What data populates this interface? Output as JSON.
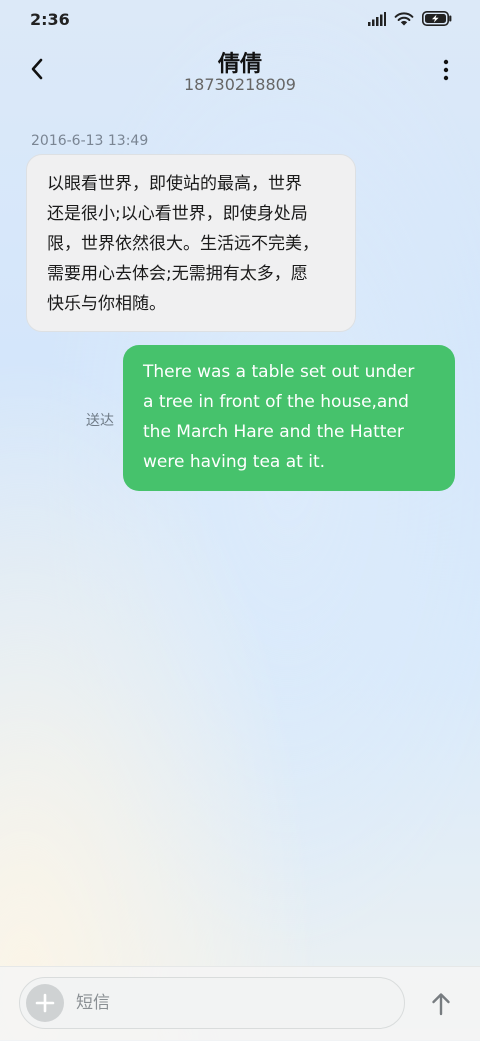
{
  "status_bar": {
    "time": "2:36",
    "icons": [
      "signal-icon",
      "wifi-icon",
      "battery-charging-icon"
    ]
  },
  "header": {
    "contact_name": "倩倩",
    "contact_number": "18730218809",
    "back_icon": "chevron-left-icon",
    "more_icon": "more-vertical-icon"
  },
  "conversation": {
    "timestamp": "2016-6-13 13:49",
    "received_message": "以眼看世界，即使站的最高，世界\n还是很小;以心看世界，即使身处局\n限，世界依然很大。生活远不完美，\n需要用心去体会;无需拥有太多，愿\n快乐与你相随。",
    "sent_message": "There was a table set out under\na tree in front of the house,and\nthe March Hare and the Hatter\nwere having tea at it.",
    "sent_status": "送达"
  },
  "composer": {
    "placeholder": "短信",
    "value": "",
    "add_icon": "plus-icon",
    "send_icon": "arrow-up-icon"
  },
  "colors": {
    "sent_bubble": "#46c26c",
    "received_bubble": "#f0f0f1",
    "text_primary": "#111111",
    "text_secondary": "#666666"
  }
}
